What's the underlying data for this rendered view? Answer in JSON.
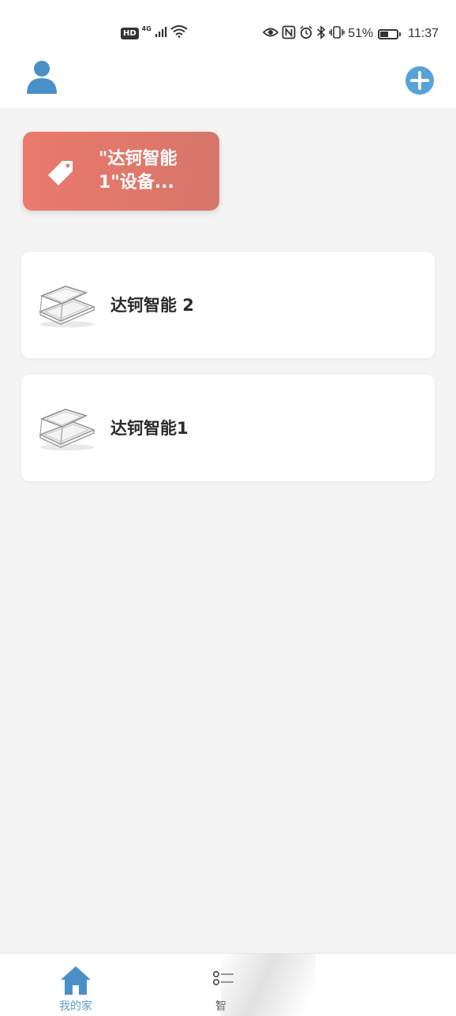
{
  "status_bar": {
    "hd_label": "HD",
    "network_type": "4G",
    "battery_percent_text": "51%",
    "battery_level": 0.51,
    "time": "11:37",
    "icons": [
      "signal-icon",
      "wifi-icon",
      "eye-icon",
      "nfc-icon",
      "alarm-icon",
      "bluetooth-icon",
      "vibrate-icon",
      "battery-icon"
    ]
  },
  "header": {
    "avatar_icon": "user-avatar-icon",
    "add_icon": "add-circle-icon",
    "accent_color": "#4a90c8"
  },
  "scene_card": {
    "label": "\"达钶智能1\"设备...",
    "icon": "tag-icon",
    "color": "#ea7a6c"
  },
  "devices": [
    {
      "name": "达钶智能 2",
      "icon": "skylight-window-icon"
    },
    {
      "name": "达钶智能1",
      "icon": "skylight-window-icon"
    }
  ],
  "bottom_nav": {
    "items": [
      {
        "label": "我的家",
        "icon": "home-icon",
        "active": true,
        "color": "#5a9ccc"
      },
      {
        "label": "智",
        "icon": "menu-list-icon",
        "active": false
      }
    ]
  }
}
